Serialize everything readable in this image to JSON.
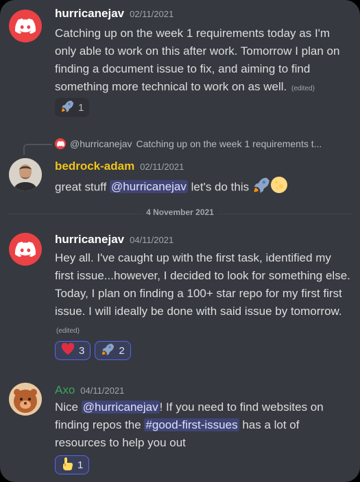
{
  "messages": [
    {
      "username": "hurricanejav",
      "timestamp": "02/11/2021",
      "text": "Catching up on the week 1 requirements today as I'm only able to work on this after work.  Tomorrow I plan on finding a document issue to fix, and aiming to find something more technical to work on as well.",
      "edited": "(edited)",
      "reactions": [
        {
          "emoji": "rocket-icon",
          "count": "1"
        }
      ]
    },
    {
      "reply": {
        "username": "@hurricanejav",
        "text": "Catching up on the week 1 requirements t..."
      },
      "username": "bedrock-adam",
      "username_color": "#f0c419",
      "timestamp": "02/11/2021",
      "text_before": "great stuff ",
      "mention": "@hurricanejav",
      "text_after": " let's do this "
    },
    {
      "divider": "4 November 2021"
    },
    {
      "username": "hurricanejav",
      "timestamp": "04/11/2021",
      "text": "Hey all.  I've caught up with the first task, identified my first issue...however, I decided to look for something else.  Today, I plan on finding a 100+ star repo for my first first issue.  I will ideally be done with said issue by tomorrow.",
      "edited": "(edited)",
      "reactions": [
        {
          "emoji": "heart-icon",
          "count": "3"
        },
        {
          "emoji": "rocket-icon",
          "count": "2"
        }
      ]
    },
    {
      "username": "Axo",
      "username_color": "#3ba55d",
      "timestamp": "04/11/2021",
      "text_1": "Nice ",
      "mention": "@hurricanejav",
      "text_2": "! If you need to find websites on finding repos the ",
      "channel": "#good-first-issues",
      "text_3": " has a lot of resources to help you out",
      "reactions": [
        {
          "emoji": "pointing-hand-icon",
          "count": "1"
        }
      ]
    }
  ]
}
